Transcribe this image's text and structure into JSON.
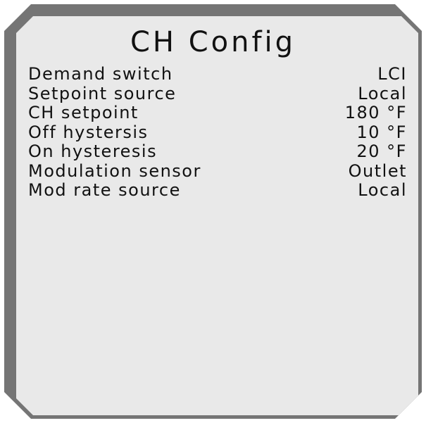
{
  "screen": {
    "title": "CH Config"
  },
  "settings": [
    {
      "label": "Demand switch",
      "value": "LCI"
    },
    {
      "label": "Setpoint source",
      "value": "Local"
    },
    {
      "label": "CH setpoint",
      "value": "180 °F"
    },
    {
      "label": "Off hystersis",
      "value": "10 °F"
    },
    {
      "label": "On hysteresis",
      "value": "20 °F"
    },
    {
      "label": "Modulation sensor",
      "value": "Outlet"
    },
    {
      "label": "Mod rate source",
      "value": "Local"
    }
  ],
  "colors": {
    "bezel": "#757575",
    "screen": "#e9e9e9",
    "text": "#111111"
  }
}
